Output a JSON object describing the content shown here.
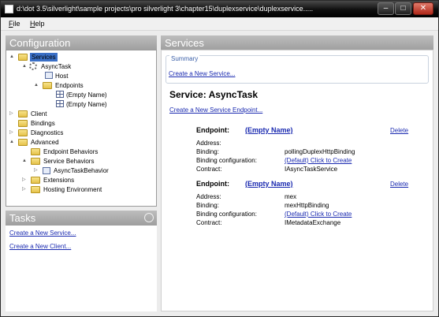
{
  "window": {
    "title": "d:\\dot 3.5\\silverlight\\sample projects\\pro silverlight 3\\chapter15\\duplexservice\\duplexservice.....",
    "minimize": "–",
    "maximize": "□",
    "close": "✕"
  },
  "menu": [
    {
      "label": "File"
    },
    {
      "label": "Help"
    }
  ],
  "configuration": {
    "header": "Configuration",
    "tree": [
      {
        "label": "Services",
        "expander": "▲"
      },
      {
        "label": "AsyncTask",
        "expander": "▲"
      },
      {
        "label": "Host",
        "expander": ""
      },
      {
        "label": "Endpoints",
        "expander": "▲"
      },
      {
        "label": "(Empty Name)",
        "expander": ""
      },
      {
        "label": "(Empty Name)",
        "expander": ""
      },
      {
        "label": "Client",
        "expander": "▷"
      },
      {
        "label": "Bindings",
        "expander": ""
      },
      {
        "label": "Diagnostics",
        "expander": "▷"
      },
      {
        "label": "Advanced",
        "expander": "▲"
      },
      {
        "label": "Endpoint Behaviors",
        "expander": ""
      },
      {
        "label": "Service Behaviors",
        "expander": "▲"
      },
      {
        "label": "AsyncTaskBehavior",
        "expander": "▷"
      },
      {
        "label": "Extensions",
        "expander": "▷"
      },
      {
        "label": "Hosting Environment",
        "expander": "▷"
      }
    ]
  },
  "tasks": {
    "header": "Tasks",
    "links": [
      "Create a New Service...",
      "Create a New Client..."
    ]
  },
  "services": {
    "header": "Services",
    "summary_label": "Summary",
    "create_service": "Create a New Service...",
    "service_title": "Service: AsyncTask",
    "create_endpoint": "Create a New Service Endpoint...",
    "endpoints": [
      {
        "heading": "Endpoint:",
        "name": "(Empty Name)",
        "delete": "Delete",
        "address_label": "Address:",
        "address": "",
        "binding_label": "Binding:",
        "binding": "pollingDuplexHttpBinding",
        "bindingconf_label": "Binding configuration:",
        "bindingconf": "(Default) Click to Create",
        "contract_label": "Contract:",
        "contract": "IAsyncTaskService"
      },
      {
        "heading": "Endpoint:",
        "name": "(Empty Name)",
        "delete": "Delete",
        "address_label": "Address:",
        "address": "mex",
        "binding_label": "Binding:",
        "binding": "mexHttpBinding",
        "bindingconf_label": "Binding configuration:",
        "bindingconf": "(Default) Click to Create",
        "contract_label": "Contract:",
        "contract": "IMetadataExchange"
      }
    ]
  }
}
